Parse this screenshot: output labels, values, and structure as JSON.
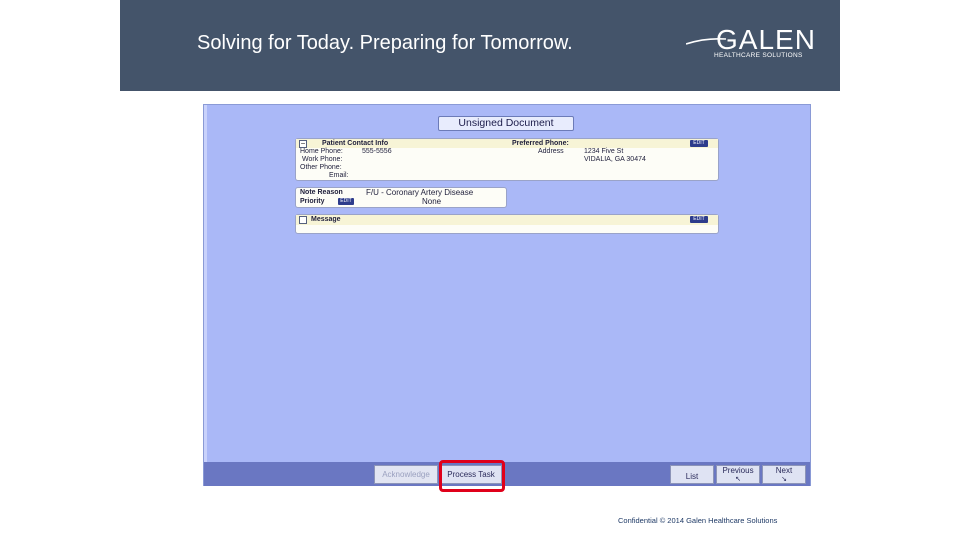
{
  "header": {
    "tagline": "Solving for Today. Preparing for Tomorrow.",
    "logo_text": "GALEN",
    "logo_subtext": "HEALTHCARE SOLUTIONS"
  },
  "document": {
    "title": "Unsigned Document",
    "contact_card": {
      "toggle": "−",
      "heading": "Patient Contact Info",
      "preferred_phone_label": "Preferred Phone:",
      "edit_label": "EDIT",
      "home_phone_label": "Home Phone:",
      "home_phone_value": "555-5556",
      "work_phone_label": "Work Phone:",
      "other_phone_label": "Other Phone:",
      "email_label": "Email:",
      "address_label": "Address",
      "address_line1": "1234 Five St",
      "address_line2": "VIDALIA, GA 30474"
    },
    "reason_card": {
      "note_reason_label": "Note Reason",
      "note_reason_value": "F/U - Coronary Artery Disease",
      "priority_label": "Priority",
      "priority_edit": "EDIT",
      "priority_value": "None"
    },
    "message_card": {
      "label": "Message",
      "edit_label": "EDIT"
    }
  },
  "toolbar": {
    "acknowledge": "Acknowledge",
    "process_task": "Process Task",
    "list": "List",
    "previous": "Previous",
    "next": "Next"
  },
  "footer": {
    "text": "Confidential © 2014 Galen Healthcare Solutions"
  },
  "colors": {
    "header_bg": "#44546a",
    "panel_bg": "#aab8f7",
    "toolbar_bg": "#6a77c2",
    "highlight": "#e0001a"
  }
}
